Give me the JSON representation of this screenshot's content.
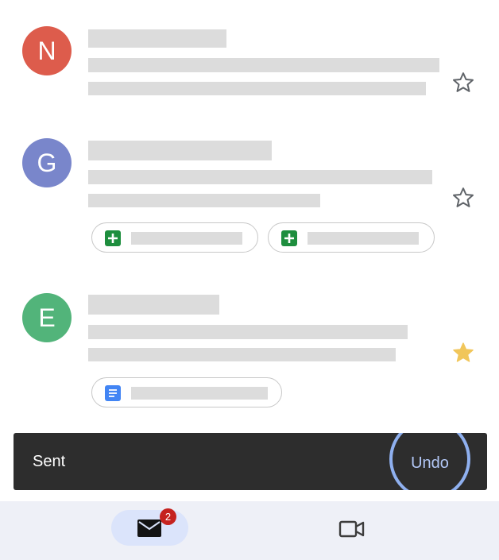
{
  "emails": [
    {
      "initial": "N",
      "avatar_color": "#dd5c4c",
      "starred": false
    },
    {
      "initial": "G",
      "avatar_color": "#7986cb",
      "starred": false
    },
    {
      "initial": "E",
      "avatar_color": "#52b47a",
      "starred": true
    }
  ],
  "colors": {
    "star_outline": "#5f6368",
    "star_filled": "#f1c65a",
    "sheets_icon": "#1e8e3e",
    "docs_icon": "#4285f4"
  },
  "snackbar": {
    "message": "Sent",
    "action_label": "Undo"
  },
  "bottom_nav": {
    "mail_badge": "2",
    "items": [
      {
        "icon": "mail-icon",
        "selected": true
      },
      {
        "icon": "video-camera-icon",
        "selected": false
      }
    ]
  }
}
